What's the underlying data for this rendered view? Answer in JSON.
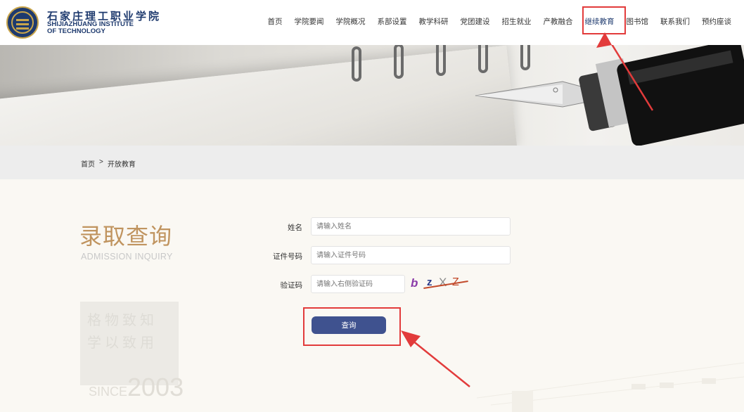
{
  "header": {
    "school_name_cn": "石家庄理工职业学院",
    "school_name_en_line1": "SHIJIAZHUANG INSTITUTE",
    "school_name_en_line2": "OF TECHNOLOGY",
    "logo_icon": "school-emblem",
    "nav": [
      {
        "label": "首页"
      },
      {
        "label": "学院要闻"
      },
      {
        "label": "学院概况"
      },
      {
        "label": "系部设置"
      },
      {
        "label": "教学科研"
      },
      {
        "label": "党团建设"
      },
      {
        "label": "招生就业"
      },
      {
        "label": "产教融合"
      },
      {
        "label": "继续教育",
        "active": true
      },
      {
        "label": "图书馆"
      },
      {
        "label": "联系我们"
      },
      {
        "label": "预约座谈"
      }
    ]
  },
  "breadcrumb": {
    "home": "首页",
    "separator": ">",
    "current": "开放教育"
  },
  "sidebar": {
    "title": "录取查询",
    "subtitle": "ADMISSION INQUIRY",
    "motto_line1": "格物致知",
    "motto_line2": "学以致用",
    "since_prefix": "SINCE",
    "since_year": "2003"
  },
  "form": {
    "name_label": "姓名",
    "name_placeholder": "请输入姓名",
    "id_label": "证件号码",
    "id_placeholder": "请输入证件号码",
    "captcha_label": "验证码",
    "captcha_placeholder": "请输入右侧验证码",
    "captcha_text": [
      "b",
      "z",
      "X",
      "Z"
    ],
    "submit_label": "查询"
  },
  "colors": {
    "primary": "#3f528f",
    "brand_navy": "#1e3a6e",
    "title_gold": "#c0945f",
    "highlight_red": "#e23b3b"
  }
}
